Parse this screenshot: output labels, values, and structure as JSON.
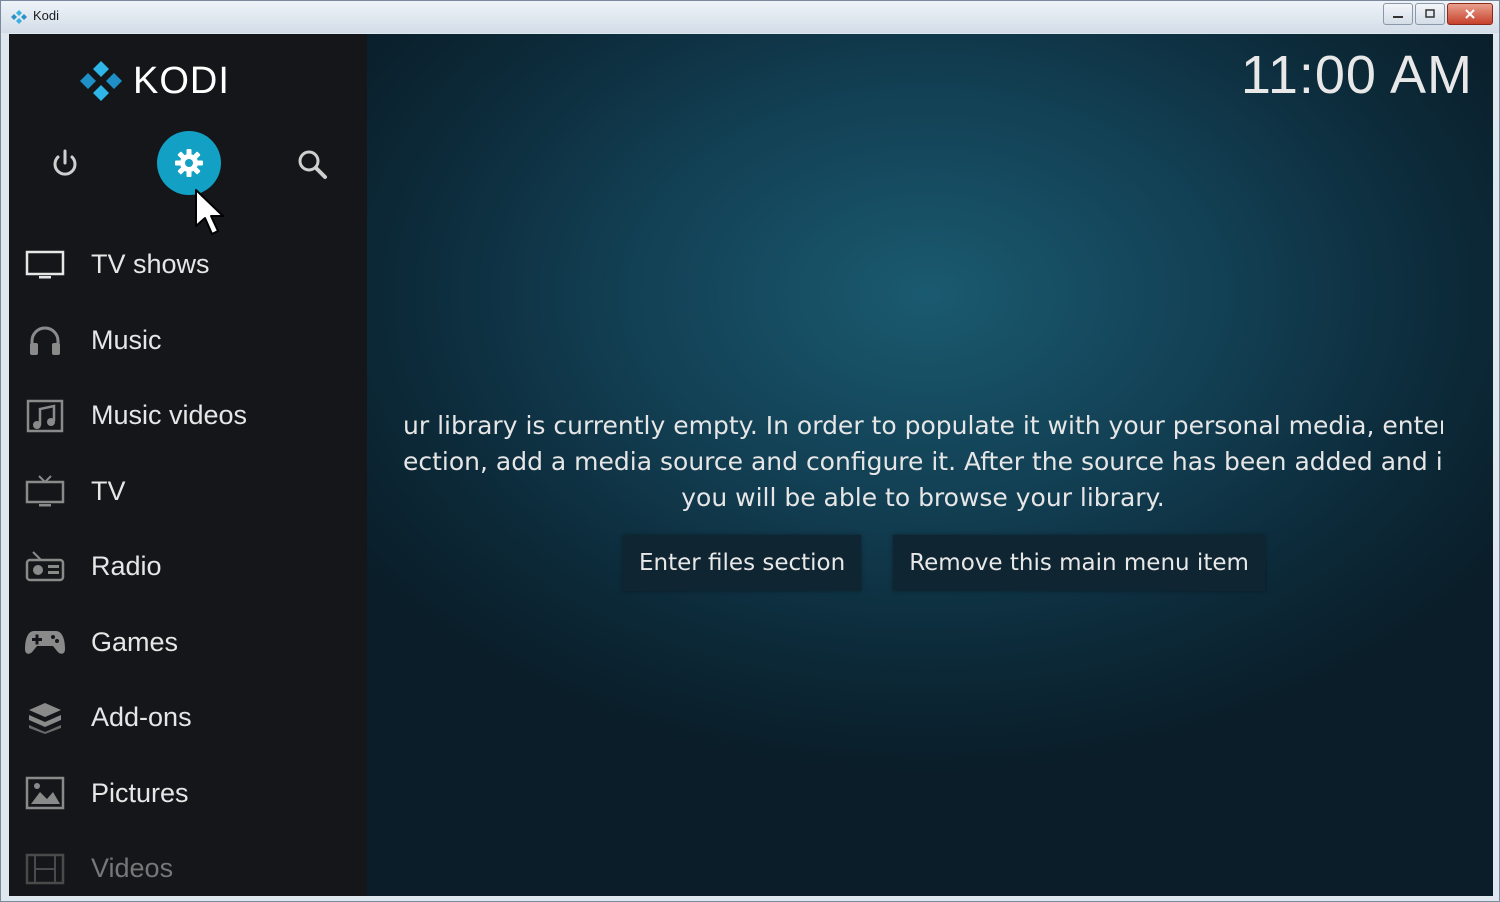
{
  "window": {
    "title": "Kodi",
    "controls": [
      "minimize",
      "maximize",
      "close"
    ]
  },
  "brand": {
    "name": "KODI"
  },
  "top_icons": [
    "power-icon",
    "settings-gear-icon",
    "search-icon"
  ],
  "clock": "11:00 AM",
  "sidebar": {
    "items": [
      {
        "label": "TV shows",
        "icon": "tv-shows-icon"
      },
      {
        "label": "Music",
        "icon": "headphones-icon"
      },
      {
        "label": "Music videos",
        "icon": "music-video-icon"
      },
      {
        "label": "TV",
        "icon": "tv-icon"
      },
      {
        "label": "Radio",
        "icon": "radio-icon"
      },
      {
        "label": "Games",
        "icon": "gamepad-icon"
      },
      {
        "label": "Add-ons",
        "icon": "addons-box-icon"
      },
      {
        "label": "Pictures",
        "icon": "picture-icon"
      },
      {
        "label": "Videos",
        "icon": "film-icon"
      }
    ]
  },
  "main": {
    "message_lines": [
      "ur library is currently empty. In order to populate it with your personal media, enter \"",
      "ection, add a media source and configure it. After the source has been added and inde",
      "you will be able to browse your library."
    ],
    "buttons": [
      "Enter files section",
      "Remove this main menu item"
    ]
  },
  "colors": {
    "accent": "#12a0c4",
    "sidebar_bg": "#141619",
    "main_bg": "#123e52"
  }
}
